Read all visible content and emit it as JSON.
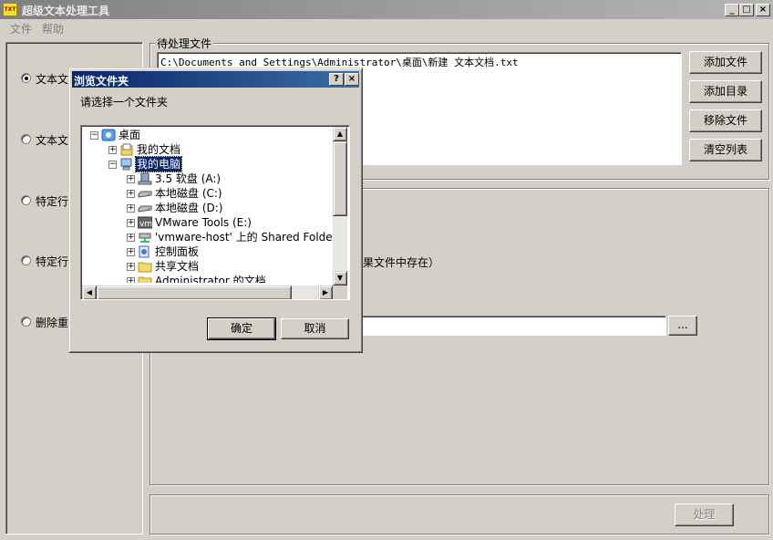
{
  "window": {
    "title": "超级文本处理工具",
    "app_icon_text": "TXT",
    "minimize": "_",
    "maximize": "□",
    "close": "×"
  },
  "menu": {
    "file": "文件",
    "help": "帮助"
  },
  "left_panel": {
    "options": [
      {
        "label": "文本文",
        "selected": true
      },
      {
        "label": "文本文",
        "selected": false
      },
      {
        "label": "特定行",
        "selected": false
      },
      {
        "label": "特定行",
        "selected": false
      },
      {
        "label": "删除重",
        "selected": false
      }
    ]
  },
  "files_group": {
    "legend": "待处理文件",
    "files": [
      "C:\\Documents and Settings\\Administrator\\桌面\\新建 文本文档.txt"
    ],
    "add_file": "添加文件",
    "add_dir": "添加目录",
    "remove_file": "移除文件",
    "clear_list": "清空列表"
  },
  "options_group": {
    "partial_text": "果文件中存在）",
    "path_value": "",
    "browse": "..."
  },
  "process_button": "处理",
  "dialog": {
    "title": "浏览文件夹",
    "help": "?",
    "close": "×",
    "prompt": "请选择一个文件夹",
    "tree": [
      {
        "label": "桌面",
        "level": 0,
        "expander": "−",
        "icon": "desktop-icon",
        "selected": false
      },
      {
        "label": "我的文档",
        "level": 1,
        "expander": "+",
        "icon": "documents-icon",
        "selected": false
      },
      {
        "label": "我的电脑",
        "level": 1,
        "expander": "−",
        "icon": "computer-icon",
        "selected": true
      },
      {
        "label": "3.5 软盘 (A:)",
        "level": 2,
        "expander": "+",
        "icon": "floppy-icon",
        "selected": false
      },
      {
        "label": "本地磁盘 (C:)",
        "level": 2,
        "expander": "+",
        "icon": "drive-icon",
        "selected": false
      },
      {
        "label": "本地磁盘 (D:)",
        "level": 2,
        "expander": "+",
        "icon": "drive-icon",
        "selected": false
      },
      {
        "label": "VMware Tools (E:)",
        "level": 2,
        "expander": "+",
        "icon": "vmware-icon",
        "selected": false
      },
      {
        "label": "'vmware-host' 上的 Shared Folders",
        "level": 2,
        "expander": "+",
        "icon": "network-drive-icon",
        "selected": false
      },
      {
        "label": "控制面板",
        "level": 2,
        "expander": "+",
        "icon": "control-panel-icon",
        "selected": false
      },
      {
        "label": "共享文档",
        "level": 2,
        "expander": "+",
        "icon": "folder-icon",
        "selected": false
      },
      {
        "label": "Administrator 的文档",
        "level": 2,
        "expander": "+",
        "icon": "folder-icon",
        "selected": false
      }
    ],
    "ok": "确定",
    "cancel": "取消"
  }
}
